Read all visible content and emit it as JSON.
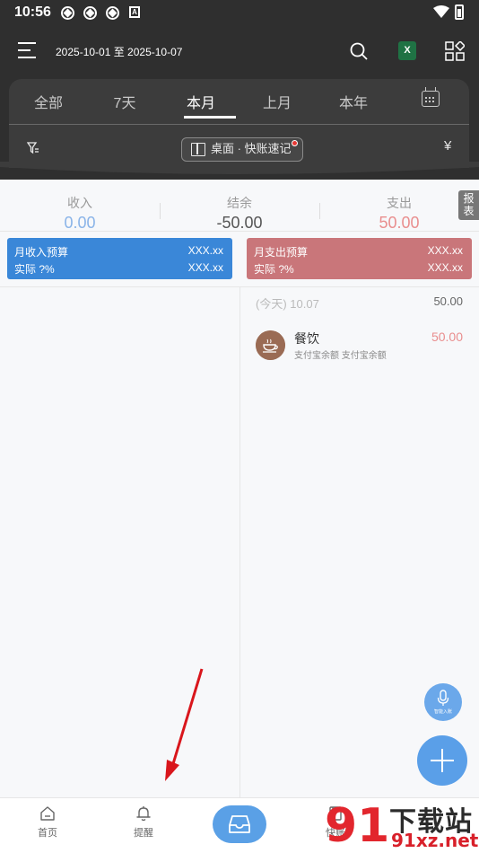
{
  "status_bar": {
    "time": "10:56",
    "app_badge": "A"
  },
  "toolbar": {
    "date_range": "2025-10-01 至 2025-10-07",
    "excel_label": "X"
  },
  "tabs": [
    {
      "label": "全部",
      "active": false
    },
    {
      "label": "7天",
      "active": false
    },
    {
      "label": "本月",
      "active": true
    },
    {
      "label": "上月",
      "active": false
    },
    {
      "label": "本年",
      "active": false
    }
  ],
  "filter_bar": {
    "quick_chip": "桌面 · 快账速记",
    "currency": "¥"
  },
  "summary": {
    "income_label": "收入",
    "income_value": "0.00",
    "balance_label": "结余",
    "balance_value": "-50.00",
    "expense_label": "支出",
    "expense_value": "50.00",
    "report_label": "报表"
  },
  "budgets": {
    "income": {
      "title": "月收入预算",
      "amount": "XXX.xx",
      "actual_label": "实际 ?%",
      "actual_amount": "XXX.xx",
      "color": "#3a87d8"
    },
    "expense": {
      "title": "月支出预算",
      "amount": "XXX.xx",
      "actual_label": "实际 ?%",
      "actual_amount": "XXX.xx",
      "color": "#c9767a"
    }
  },
  "day_group": {
    "date": "(今天) 10.07",
    "total": "50.00"
  },
  "entries": [
    {
      "title": "餐饮",
      "subtitle": "支付宝余额 支付宝余额",
      "amount": "50.00",
      "icon": "coffee-cup-icon"
    }
  ],
  "fab": {
    "mic_label": "智能入账"
  },
  "bottom_nav": [
    {
      "label": "首页",
      "icon": "home-icon"
    },
    {
      "label": "提醒",
      "icon": "bell-icon"
    },
    {
      "label": "",
      "icon": "inbox-icon"
    },
    {
      "label": "快账",
      "icon": "book-icon"
    }
  ],
  "watermark": {
    "big": "下载站",
    "small": "91xz.net",
    "logo": "91"
  },
  "colors": {
    "header": "#2f2f2f",
    "income": "#8ab4e8",
    "expense": "#e98e8e",
    "accent": "#5a9fe8"
  }
}
